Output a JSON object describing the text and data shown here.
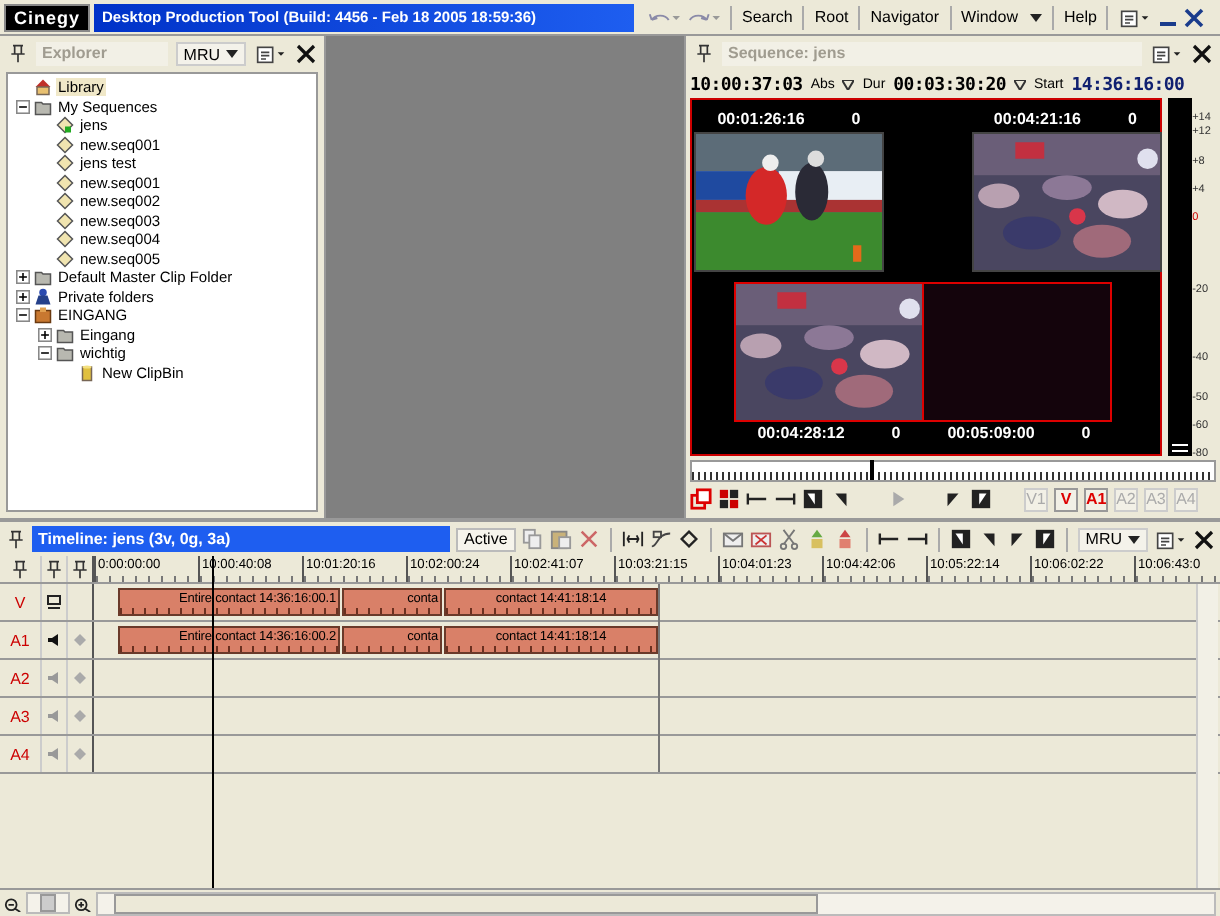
{
  "app": {
    "logo": "Cinegy",
    "title": "Desktop Production Tool (Build: 4456 - Feb 18 2005 18:59:36)",
    "menu": [
      "Search",
      "Root",
      "Navigator",
      "Window",
      "Help"
    ]
  },
  "explorer": {
    "title": "Explorer",
    "mru": "MRU",
    "tree": [
      {
        "label": "Library",
        "kind": "library",
        "selected": true
      },
      {
        "label": "My Sequences",
        "kind": "folder",
        "selected": false,
        "expanded": true,
        "children": [
          {
            "label": "jens",
            "kind": "sequence-open",
            "selected": false
          },
          {
            "label": "new.seq001",
            "kind": "sequence",
            "selected": false
          },
          {
            "label": "jens test",
            "kind": "sequence",
            "selected": false
          },
          {
            "label": "new.seq001",
            "kind": "sequence",
            "selected": false
          },
          {
            "label": "new.seq002",
            "kind": "sequence",
            "selected": false
          },
          {
            "label": "new.seq003",
            "kind": "sequence",
            "selected": false
          },
          {
            "label": "new.seq004",
            "kind": "sequence",
            "selected": false
          },
          {
            "label": "new.seq005",
            "kind": "sequence",
            "selected": false
          }
        ]
      },
      {
        "label": "Default Master Clip Folder",
        "kind": "folder",
        "selected": false,
        "expanded": false
      },
      {
        "label": "Private folders",
        "kind": "private",
        "selected": false,
        "expanded": false
      },
      {
        "label": "EINGANG",
        "kind": "bin",
        "selected": false,
        "expanded": true,
        "children": [
          {
            "label": "Eingang",
            "kind": "folder",
            "selected": false,
            "expanded": false
          },
          {
            "label": "wichtig",
            "kind": "folder",
            "selected": false,
            "expanded": true,
            "children": [
              {
                "label": "New ClipBin",
                "kind": "clipbin",
                "selected": false
              }
            ]
          }
        ]
      }
    ]
  },
  "sequence": {
    "title": "Sequence: jens",
    "position": "10:00:37:03",
    "position_mode": "Abs",
    "duration_label": "Dur",
    "duration": "00:03:30:20",
    "start_label": "Start",
    "start": "14:36:16:00",
    "tiles": [
      {
        "timecode": "00:01:26:16",
        "count": "0",
        "kind": "football"
      },
      {
        "timecode": "00:04:21:16",
        "count": "0",
        "kind": "crowd"
      },
      {
        "timecode": "00:04:28:12",
        "count": "0",
        "kind": "crowd"
      },
      {
        "timecode": "00:05:09:00",
        "count": "0",
        "kind": "empty"
      }
    ],
    "meter_scale": [
      "+14",
      "+12",
      "+8",
      "+4",
      "0",
      "-20",
      "-40",
      "-50",
      "-60",
      "-80"
    ],
    "scrubber": {
      "level": 0.34
    },
    "tracks": [
      {
        "label": "V1",
        "on": false
      },
      {
        "label": "V",
        "on": true
      },
      {
        "label": "A1",
        "on": true
      },
      {
        "label": "A2",
        "on": false
      },
      {
        "label": "A3",
        "on": false
      },
      {
        "label": "A4",
        "on": false
      }
    ]
  },
  "timeline": {
    "title": "Timeline: jens (3v, 0g, 3a)",
    "active": "Active",
    "mru": "MRU",
    "ruler": [
      "0:00:00:00",
      "10:00:40:08",
      "10:01:20:16",
      "10:02:00:24",
      "10:02:41:07",
      "10:03:21:15",
      "10:04:01:23",
      "10:04:42:06",
      "10:05:22:14",
      "10:06:02:22",
      "10:06:43:0"
    ],
    "tracks": [
      {
        "label": "V",
        "kind": "video",
        "clips": [
          "Entire contact 14:36:16:00.1",
          "conta",
          "contact 14:41:18:14"
        ]
      },
      {
        "label": "A1",
        "kind": "audio",
        "clips": [
          "Entire contact 14:36:16:00.2",
          "conta",
          "contact 14:41:18:14"
        ]
      },
      {
        "label": "A2",
        "kind": "audio"
      },
      {
        "label": "A3",
        "kind": "audio"
      },
      {
        "label": "A4",
        "kind": "audio"
      }
    ],
    "zoom": {
      "level": 0.5
    }
  }
}
